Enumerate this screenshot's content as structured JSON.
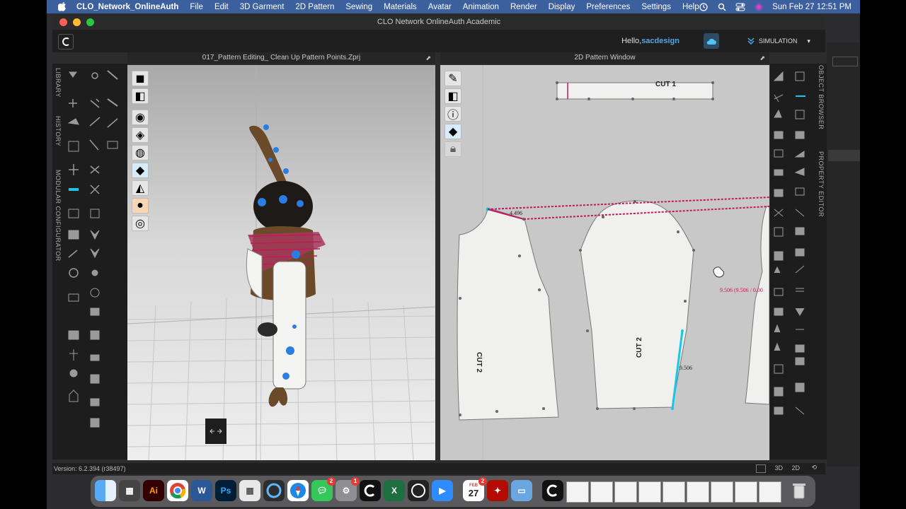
{
  "menubar": {
    "app_name": "CLO_Network_OnlineAuth",
    "items": [
      "File",
      "Edit",
      "3D Garment",
      "2D Pattern",
      "Sewing",
      "Materials",
      "Avatar",
      "Animation",
      "Render",
      "Display",
      "Preferences",
      "Settings",
      "Help"
    ],
    "datetime": "Sun Feb 27  12:51 PM"
  },
  "window": {
    "title": "CLO Network OnlineAuth Academic",
    "hello_prefix": "Hello,",
    "username": "sacdesign",
    "mode": "SIMULATION"
  },
  "left_tabs": [
    "LIBRARY",
    "HISTORY",
    "MODULAR CONFIGURATOR"
  ],
  "right_tabs": [
    "OBJECT BROWSER",
    "PROPERTY EDITOR"
  ],
  "view3d": {
    "title": "017_Pattern Editing_ Clean Up Pattern Points.Zprj"
  },
  "view2d": {
    "title": "2D Pattern Window",
    "labels": {
      "cut1": "CUT 1",
      "cut2_left": "CUT 2",
      "cut2_center": "CUT 2",
      "measure_a": "4.496",
      "measure_b": "9.506",
      "measure_c": "9.506 (9.506 / 0.00"
    }
  },
  "status": {
    "version": "Version: 6.2.394 (r38497)",
    "btn_3d": "3D",
    "btn_2d": "2D"
  },
  "dock": {
    "calendar_month": "FEB",
    "calendar_day": "27",
    "badges": {
      "messages": "2",
      "settings": "1",
      "calendar": "2"
    },
    "labels": {
      "illustrator": "Ai",
      "photoshop": "Ps",
      "word": "W",
      "excel": "X"
    }
  },
  "colors": {
    "menubar": "#3c5f9e",
    "accent_blue": "#4fa8e8",
    "seam_red": "#c2185b",
    "highlight_cyan": "#18c7e8"
  }
}
